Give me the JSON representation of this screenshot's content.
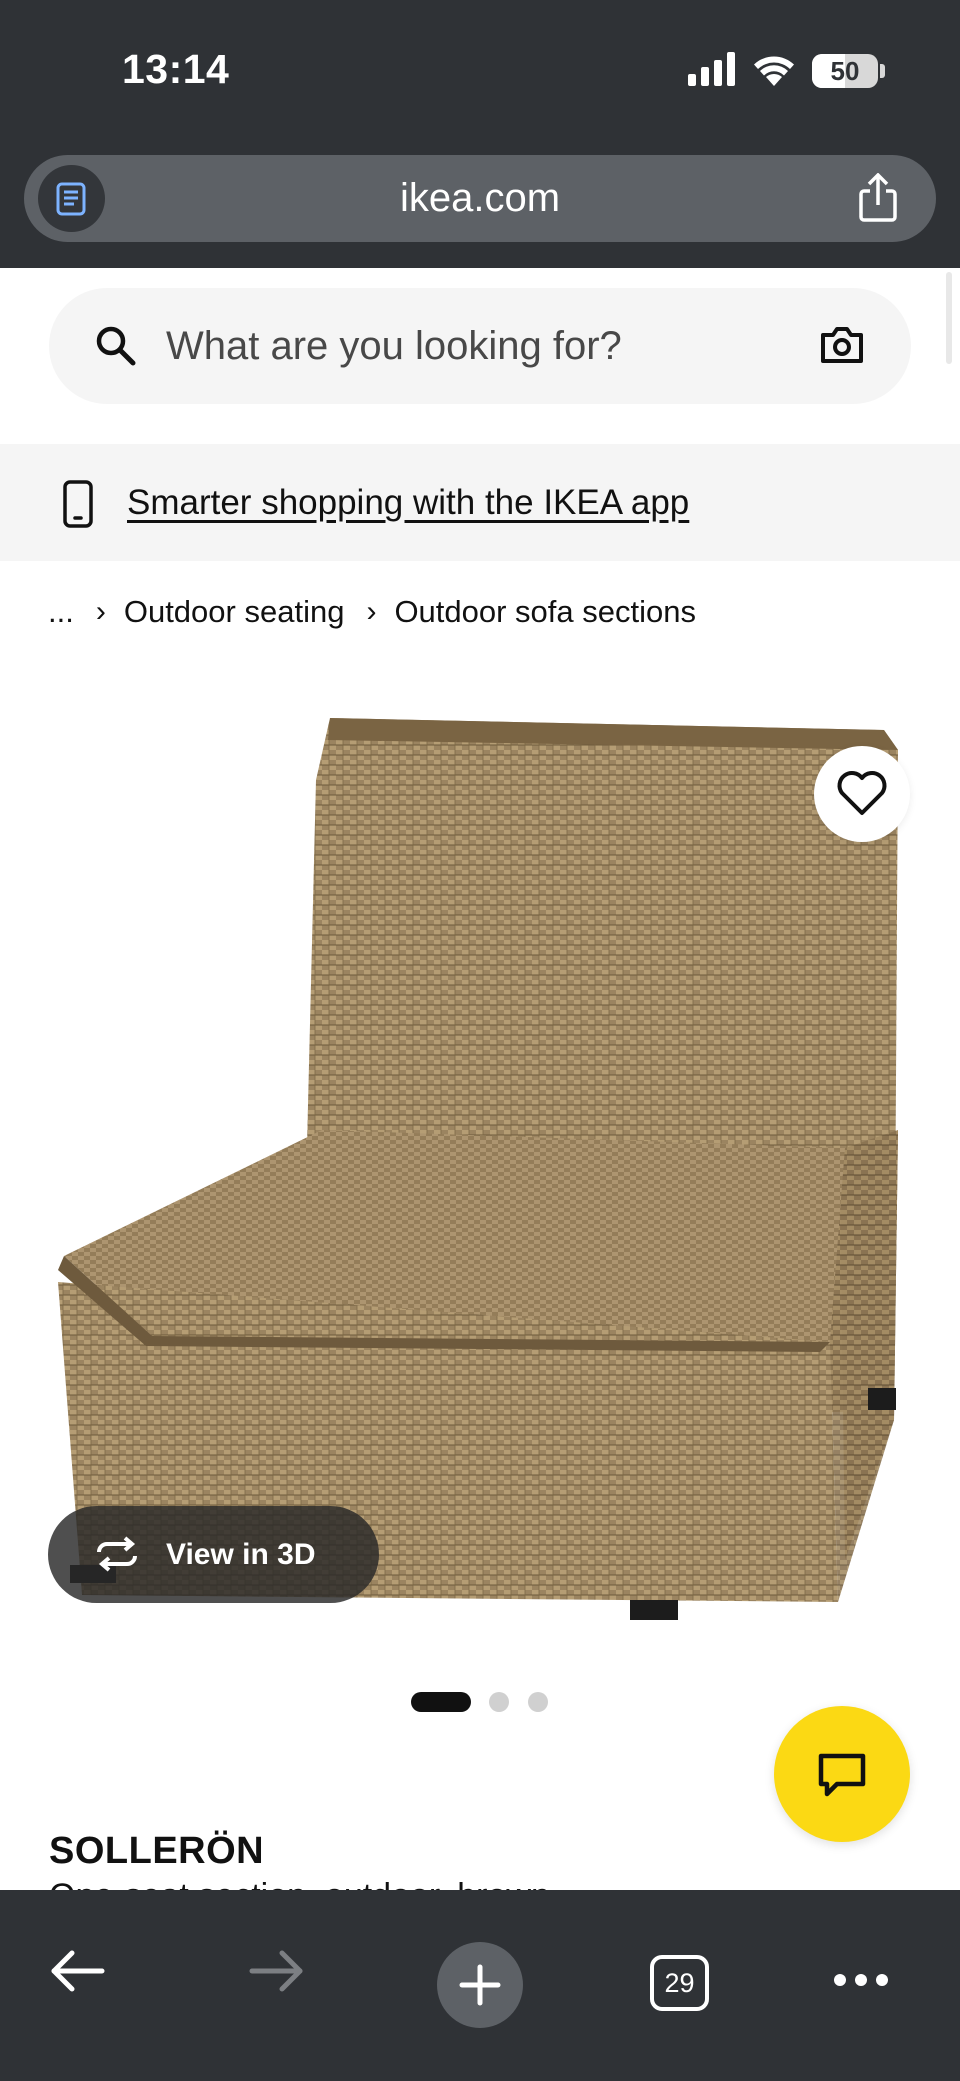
{
  "status_bar": {
    "time": "13:14",
    "battery": "50",
    "icons": [
      "cellular-signal-icon",
      "wifi-icon",
      "battery-icon"
    ]
  },
  "browser": {
    "url": "ikea.com",
    "icons": [
      "reader-icon",
      "share-icon"
    ]
  },
  "search": {
    "placeholder": "What are you looking for?",
    "icons": [
      "search-icon",
      "camera-icon"
    ]
  },
  "app_banner": {
    "link_text": "Smarter shopping with the IKEA app",
    "icon": "phone-icon"
  },
  "breadcrumb": {
    "ellipsis": "...",
    "items": [
      "Outdoor seating",
      "Outdoor sofa sections"
    ],
    "separator": "›"
  },
  "product": {
    "image_alt": "Wicker outdoor armless chair section",
    "view_3d_label": "View in 3D",
    "carousel": {
      "total": 3,
      "active": 1
    },
    "name": "SOLLERÖN",
    "description": "One-seat section, outdoor, brown"
  },
  "chat": {
    "icon": "chat-icon"
  },
  "bottom_nav": {
    "tab_count": "29",
    "icons": [
      "back-arrow-icon",
      "forward-arrow-icon",
      "plus-icon",
      "tabs-icon",
      "more-icon"
    ]
  },
  "colors": {
    "browser_chrome": "#2f3236",
    "url_pill": "#5d6166",
    "search_bg": "#f5f5f5",
    "ikea_yellow": "#fbd914",
    "wicker": "#9b8460"
  }
}
